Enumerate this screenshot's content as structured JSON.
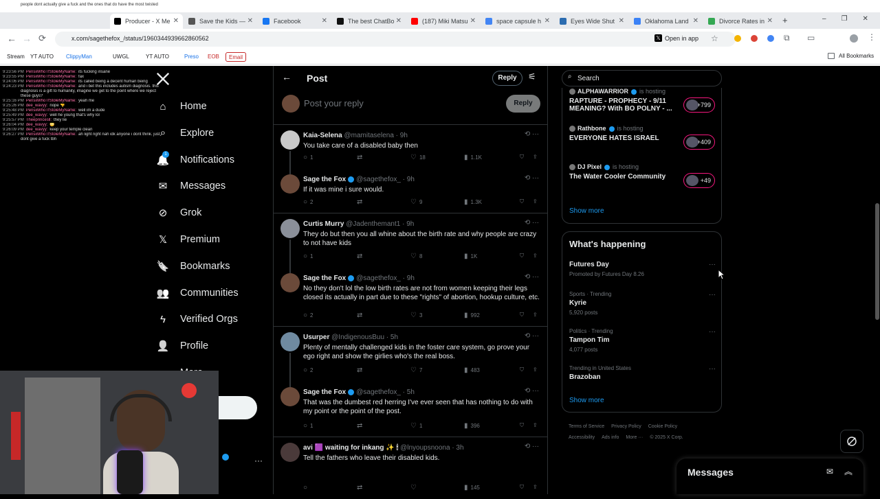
{
  "browser": {
    "tabs": [
      {
        "title": "Producer - X Me",
        "color": "#000000"
      },
      {
        "title": "Save the Kids —",
        "color": "#555555"
      },
      {
        "title": "Facebook",
        "color": "#1877f2"
      },
      {
        "title": "The best ChatBo",
        "color": "#111111"
      },
      {
        "title": "(187) Miki Matsu",
        "color": "#ff0000"
      },
      {
        "title": "space capsule h",
        "color": "#4285f4"
      },
      {
        "title": "Eyes Wide Shut",
        "color": "#2b6cb0"
      },
      {
        "title": "Oklahoma Land",
        "color": "#3b82f6"
      },
      {
        "title": "Divorce Rates in",
        "color": "#34a853"
      }
    ],
    "url": "x.com/sagethefox_/status/1960344939662860562",
    "open_in_app": "Open in app",
    "bookmarks": [
      "Stream",
      "YT AUTO",
      "ClippyMan",
      "UWGL",
      "YT AUTO",
      "Preso",
      "EOB",
      "Email"
    ],
    "all_bookmarks": "All Bookmarks"
  },
  "nav": {
    "items": [
      {
        "label": "Home",
        "icon": "home-icon"
      },
      {
        "label": "Explore",
        "icon": "search-icon"
      },
      {
        "label": "Notifications",
        "icon": "bell-icon"
      },
      {
        "label": "Messages",
        "icon": "mail-icon"
      },
      {
        "label": "Grok",
        "icon": "grok-icon"
      },
      {
        "label": "Premium",
        "icon": "x-icon"
      },
      {
        "label": "Bookmarks",
        "icon": "bookmark-icon"
      },
      {
        "label": "Communities",
        "icon": "people-icon"
      },
      {
        "label": "Verified Orgs",
        "icon": "lightning-icon"
      },
      {
        "label": "Profile",
        "icon": "person-icon"
      },
      {
        "label": "More",
        "icon": "more-icon"
      }
    ],
    "notification_badge": "1"
  },
  "header": {
    "title": "Post",
    "reply_button": "Reply",
    "reply_placeholder": "Post your reply",
    "reply_submit": "Reply"
  },
  "posts": [
    {
      "name": "Kaia-Selena",
      "handle": "@mamitaselena · 9h",
      "text": "You take care of a disabled baby then",
      "replies": "1",
      "retweets": "",
      "likes": "18",
      "views": "1.1K",
      "avatar_color": "#c9c9c9"
    },
    {
      "name": "Sage the Fox",
      "handle": "@sagethefox_ · 9h",
      "text": "If it was mine i sure would.",
      "replies": "2",
      "retweets": "",
      "likes": "9",
      "views": "1.3K",
      "avatar_color": "#6b4a3a"
    },
    {
      "name": "Curtis Murry",
      "handle": "@Jadenthemant1 · 9h",
      "text": "They do but then you all whine about the birth rate and why people are crazy to not have kids",
      "replies": "1",
      "retweets": "",
      "likes": "8",
      "views": "1K",
      "avatar_color": "#8a8f99"
    },
    {
      "name": "Sage the Fox",
      "handle": "@sagethefox_ · 9h",
      "text": "No they don't lol the low birth rates are not from women keeping their legs closed its actually in part due to these \"rights\" of abortion, hookup culture, etc.",
      "replies": "2",
      "retweets": "",
      "likes": "3",
      "views": "992",
      "avatar_color": "#6b4a3a"
    },
    {
      "name": "Usurper",
      "handle": "@IndigenousBuu · 5h",
      "text": "Plenty of mentally challenged kids in the foster care system, go prove your ego right and show the girlies who's the real boss.",
      "replies": "2",
      "retweets": "",
      "likes": "7",
      "views": "483",
      "avatar_color": "#6f8aa0"
    },
    {
      "name": "Sage the Fox",
      "handle": "@sagethefox_ · 5h",
      "text": "That was the dumbest red herring I've ever seen that has nothing to do with my point or the point of the post.",
      "replies": "1",
      "retweets": "",
      "likes": "1",
      "views": "396",
      "avatar_color": "#6b4a3a"
    },
    {
      "name": "avi 🟪 waiting for inkang ✨ 🕯",
      "handle": "@lnyoupsnoona · 3h",
      "text": "Tell the fathers who leave their disabled kids.",
      "replies": "",
      "retweets": "",
      "likes": "",
      "views": "145",
      "avatar_color": "#4a3a3a"
    }
  ],
  "spaces": [
    {
      "host": "ALPHAWARRIOR",
      "tag": "is hosting",
      "title": "RAPTURE - PROPHECY - 9/11 MEANING? With BO POLNY - ...",
      "count": "+799"
    },
    {
      "host": "Rathbone",
      "tag": "is hosting",
      "title": "EVERYONE HATES ISRAEL",
      "count": "+409"
    },
    {
      "host": "DJ Pixel",
      "tag": "is hosting",
      "title": "The Water Cooler Community",
      "count": "+49"
    }
  ],
  "spaces_show_more": "Show more",
  "search_placeholder": "Search",
  "happening": {
    "title": "What's happening",
    "items": [
      {
        "category": "",
        "name": "Futures Day",
        "meta": "Promoted by Futures Day 8.26"
      },
      {
        "category": "Sports · Trending",
        "name": "Kyrie",
        "meta": "5,920 posts"
      },
      {
        "category": "Politics · Trending",
        "name": "Tampon Tim",
        "meta": "4,077 posts"
      },
      {
        "category": "Trending in United States",
        "name": "Brazoban",
        "meta": ""
      }
    ],
    "show_more": "Show more"
  },
  "footer": [
    "Terms of Service",
    "Privacy Policy",
    "Cookie Policy",
    "Accessibility",
    "Ads info",
    "More ···",
    "© 2025 X Corp."
  ],
  "messages_drawer": "Messages",
  "chat": {
    "header": "people dont actually give a fuck and the ones that do have the most twisted",
    "lines": [
      {
        "time": "9:23:56 PM",
        "user": "PensiiWhoTfStoleMyName:",
        "text": "its fucking insane"
      },
      {
        "time": "9:23:55 PM",
        "user": "PensiiWhoTfStoleMyName:",
        "text": "fax"
      },
      {
        "time": "9:24:06 PM",
        "user": "PensiiWhoTfStoleMyName:",
        "text": "its called being a decent human being"
      },
      {
        "time": "9:24:23 PM",
        "user": "PensiiWhoTfStoleMyName:",
        "text": "and i bet this includes autism diagnosis. this"
      },
      {
        "time": "",
        "user": "",
        "text": "diagnosis is a gift to humanity, imagine we get to the point where we reject"
      },
      {
        "time": "",
        "user": "",
        "text": "these guys?"
      },
      {
        "time": "9:25:16 PM",
        "user": "PensiiWhoTfStoleMyName:",
        "text": "yeah me"
      },
      {
        "time": "9:25:26 PM",
        "user": "dee_wavyy:",
        "text": "nope 👎"
      },
      {
        "time": "9:25:48 PM",
        "user": "PensiiWhoTfStoleMyName:",
        "text": "well im a dude"
      },
      {
        "time": "9:25:49 PM",
        "user": "dee_wavyy:",
        "text": "well he young that's why lol"
      },
      {
        "time": "9:25:57 PM",
        "user": "Theeprincesll:",
        "text": "they lie"
      },
      {
        "time": "9:26:04 PM",
        "user": "dee_wavyy:",
        "text": "😳"
      },
      {
        "time": "9:26:09 PM",
        "user": "dee_wavyy:",
        "text": "keep your temple clean"
      },
      {
        "time": "9:26:27 PM",
        "user": "PensiiWhoTfStoleMyName:",
        "text": "ah light right nah idk anyone i dont think. just"
      },
      {
        "time": "",
        "user": "",
        "text": "dont give a fuck tbh"
      }
    ]
  }
}
